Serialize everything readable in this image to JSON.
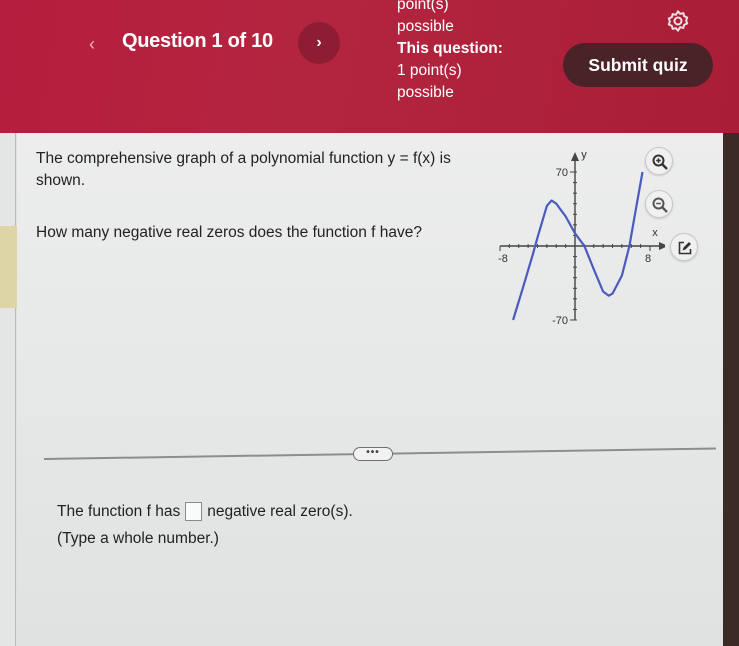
{
  "header": {
    "prev_label": "‹",
    "question_title": "Question 1 of 10",
    "next_label": "›",
    "points_lines": [
      "point(s)",
      "possible",
      "This question:",
      "1 point(s)",
      "possible"
    ],
    "settings_icon": "gear-icon",
    "submit_label": "Submit quiz"
  },
  "question": {
    "line1": "The comprehensive graph of a polynomial function y = f(x) is shown.",
    "line2": "How many negative real zeros does the function f have?"
  },
  "graph_tools": {
    "zoom_in_icon": "zoom-in-icon",
    "zoom_out_icon": "zoom-out-icon",
    "popout_icon": "external-link-icon"
  },
  "divider": {
    "handle_label": "•••"
  },
  "answer": {
    "prefix": "The function f has",
    "value": "",
    "suffix": "negative real zero(s).",
    "hint": "(Type a whole number.)"
  },
  "chart_data": {
    "type": "line",
    "title": "",
    "xlabel": "x",
    "ylabel": "y",
    "xlim": [
      -8,
      8
    ],
    "ylim": [
      -70,
      70
    ],
    "x_tick_labels": [
      "-8",
      "8"
    ],
    "y_tick_labels": [
      "70",
      "-70"
    ],
    "x_ticks_every": 1,
    "y_ticks_every": 10,
    "grid": false,
    "color": "#4a5bbf",
    "series": [
      {
        "name": "f(x)",
        "x": [
          -6.6,
          -5.5,
          -4.5,
          -4,
          -3,
          -2.5,
          -2,
          -1,
          0,
          1,
          2,
          3,
          3.6,
          4,
          5,
          5.8,
          6.5,
          7.2
        ],
        "y": [
          -70,
          -38,
          -8,
          8,
          38,
          43,
          40,
          28,
          12,
          0,
          -22,
          -43,
          -47,
          -45,
          -28,
          0,
          35,
          70
        ]
      }
    ]
  }
}
